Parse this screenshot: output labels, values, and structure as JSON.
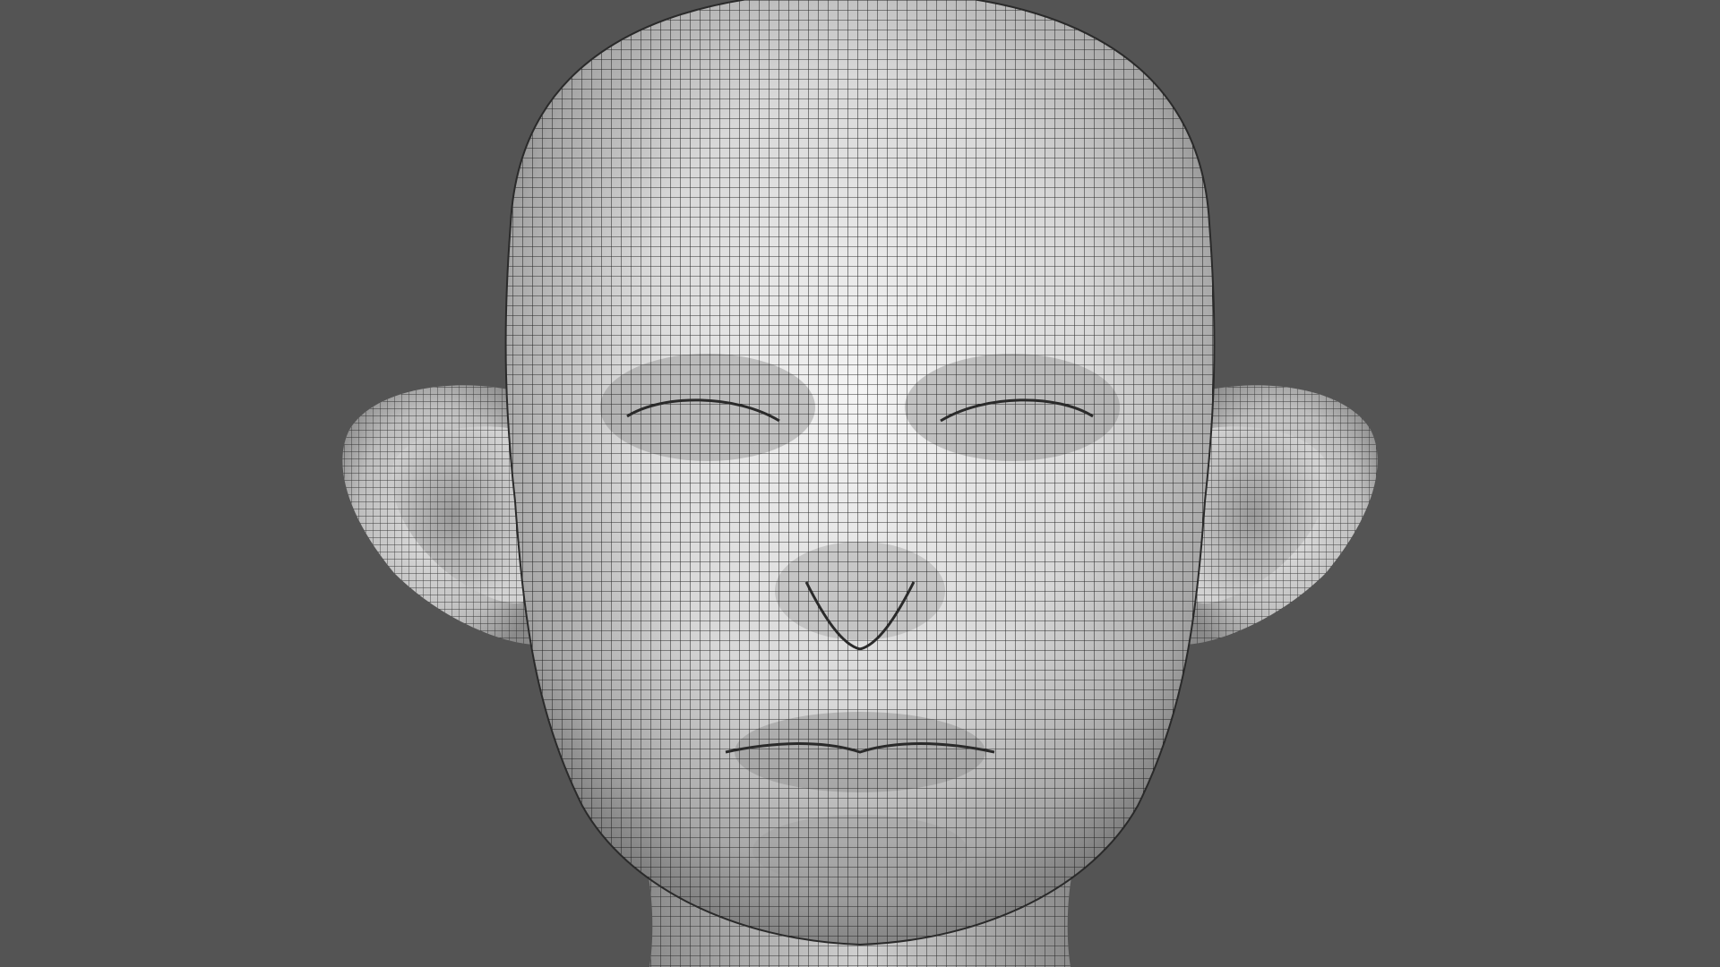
{
  "viewport": {
    "background_color": "#545454",
    "subject": "head-mesh",
    "render_mode": "wireframe-on-shaded",
    "mesh_surface_color": "#dcdcdc",
    "mesh_shadow_color": "#6e6e6e",
    "wire_color": "#1a1a1a"
  }
}
